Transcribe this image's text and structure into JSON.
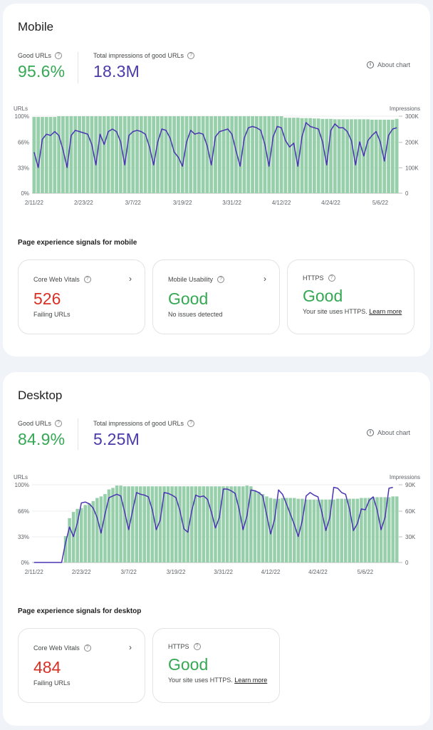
{
  "colors": {
    "good_green": "#34a853",
    "impressions_purple": "#4a3aaa",
    "failing_red": "#d93025",
    "bar_green": "#97cfab",
    "line_purple": "#4b34b4"
  },
  "mobile": {
    "title": "Mobile",
    "good_urls_label": "Good URLs",
    "good_urls_value": "95.6%",
    "impressions_label": "Total impressions of good URLs",
    "impressions_value": "18.3M",
    "about_chart": "About chart",
    "signals_title": "Page experience signals for mobile",
    "cards": [
      {
        "label": "Core Web Vitals",
        "value": "526",
        "sub": "Failing URLs",
        "has_chevron": true
      },
      {
        "label": "Mobile Usability",
        "value": "Good",
        "sub": "No issues detected",
        "has_chevron": true
      },
      {
        "label": "HTTPS",
        "value": "Good",
        "sub": "Your site uses HTTPS.",
        "link": "Learn more",
        "has_chevron": false
      }
    ]
  },
  "desktop": {
    "title": "Desktop",
    "good_urls_label": "Good URLs",
    "good_urls_value": "84.9%",
    "impressions_label": "Total impressions of good URLs",
    "impressions_value": "5.25M",
    "about_chart": "About chart",
    "signals_title": "Page experience signals for desktop",
    "cards": [
      {
        "label": "Core Web Vitals",
        "value": "484",
        "sub": "Failing URLs",
        "has_chevron": true
      },
      {
        "label": "HTTPS",
        "value": "Good",
        "sub": "Your site uses HTTPS.",
        "link": "Learn more",
        "has_chevron": false
      }
    ]
  },
  "chart_data": [
    {
      "type": "bar",
      "title": "Mobile",
      "ylabel": "URLs",
      "y2label": "Impressions",
      "ylim": [
        0,
        100
      ],
      "y2lim": [
        0,
        300000
      ],
      "yticks": [
        "0%",
        "33%",
        "66%",
        "100%"
      ],
      "y2ticks": [
        "0",
        "100K",
        "200K",
        "300K"
      ],
      "xticks": [
        "2/11/22",
        "2/23/22",
        "3/7/22",
        "3/19/22",
        "3/31/22",
        "4/12/22",
        "4/24/22",
        "5/6/22"
      ],
      "grid": true,
      "series": [
        {
          "name": "Good URLs (%)",
          "type": "bar",
          "axis": "left",
          "values": [
            99,
            99,
            99,
            99,
            99,
            99,
            100,
            100,
            100,
            100,
            100,
            100,
            100,
            100,
            100,
            100,
            100,
            100,
            100,
            100,
            100,
            100,
            100,
            100,
            100,
            100,
            100,
            100,
            100,
            100,
            100,
            100,
            100,
            100,
            100,
            100,
            100,
            100,
            100,
            100,
            100,
            100,
            100,
            100,
            100,
            100,
            100,
            100,
            100,
            100,
            100,
            100,
            100,
            100,
            100,
            100,
            100,
            100,
            100,
            100,
            100,
            98,
            98,
            98,
            98,
            97.5,
            97.5,
            97.5,
            97,
            97,
            96.5,
            96.5,
            96.5,
            96,
            96,
            96,
            96,
            96,
            96,
            96,
            96,
            96,
            95.5,
            95.5,
            95.5,
            95.5,
            95.5,
            95.5,
            96.5
          ]
        },
        {
          "name": "Impressions",
          "type": "line",
          "axis": "right",
          "values": [
            160000,
            100000,
            210000,
            230000,
            225000,
            240000,
            225000,
            170000,
            100000,
            225000,
            245000,
            240000,
            235000,
            230000,
            190000,
            110000,
            230000,
            190000,
            240000,
            250000,
            240000,
            200000,
            110000,
            225000,
            240000,
            245000,
            240000,
            230000,
            180000,
            110000,
            200000,
            250000,
            245000,
            215000,
            160000,
            140000,
            105000,
            200000,
            245000,
            230000,
            235000,
            230000,
            185000,
            110000,
            220000,
            240000,
            245000,
            250000,
            230000,
            165000,
            105000,
            215000,
            255000,
            260000,
            255000,
            245000,
            190000,
            105000,
            220000,
            260000,
            255000,
            205000,
            180000,
            195000,
            105000,
            220000,
            275000,
            260000,
            255000,
            250000,
            200000,
            110000,
            245000,
            270000,
            255000,
            255000,
            240000,
            205000,
            110000,
            200000,
            145000,
            205000,
            225000,
            240000,
            200000,
            125000,
            225000,
            250000,
            255000
          ]
        }
      ]
    },
    {
      "type": "bar",
      "title": "Desktop",
      "ylabel": "URLs",
      "y2label": "Impressions",
      "ylim": [
        0,
        100
      ],
      "y2lim": [
        0,
        90000
      ],
      "yticks": [
        "0%",
        "33%",
        "66%",
        "100%"
      ],
      "y2ticks": [
        "0",
        "30K",
        "60K",
        "90K"
      ],
      "xticks": [
        "2/11/22",
        "2/23/22",
        "3/7/22",
        "3/19/22",
        "3/31/22",
        "4/12/22",
        "4/24/22",
        "5/6/22"
      ],
      "grid": true,
      "series": [
        {
          "name": "Good URLs (%)",
          "type": "bar",
          "axis": "left",
          "values": [
            0,
            0,
            0,
            0,
            0,
            0,
            0,
            0,
            34,
            57,
            65,
            69,
            70,
            74,
            76,
            79,
            83,
            85,
            88,
            94,
            96,
            99,
            99,
            98,
            98,
            98,
            98,
            98,
            98,
            98,
            98,
            98,
            98,
            98,
            98,
            98,
            98,
            98,
            98,
            98,
            98,
            98,
            98,
            98,
            98,
            98,
            98,
            98,
            98,
            98,
            98,
            98,
            98,
            98,
            99,
            98,
            93,
            91,
            88,
            85,
            83,
            82,
            82,
            83,
            83,
            83,
            83,
            82,
            82,
            81,
            81,
            81,
            81,
            81,
            81,
            81,
            81,
            82,
            82,
            82,
            82,
            82,
            82,
            83,
            83,
            83,
            84,
            84,
            84,
            84,
            84,
            85,
            85
          ]
        },
        {
          "name": "Impressions",
          "type": "line",
          "axis": "right",
          "values": [
            0,
            0,
            0,
            0,
            0,
            0,
            0,
            0,
            23000,
            41000,
            30000,
            46000,
            69000,
            70000,
            68000,
            63000,
            52000,
            34000,
            56000,
            75000,
            77000,
            79000,
            77000,
            58000,
            38000,
            60000,
            81000,
            79000,
            78000,
            76000,
            61000,
            38000,
            49000,
            81000,
            80000,
            78000,
            75000,
            60000,
            39000,
            35000,
            60000,
            78000,
            76000,
            77000,
            73000,
            58000,
            40000,
            52000,
            85000,
            85000,
            83000,
            80000,
            62000,
            38000,
            54000,
            84000,
            83000,
            81000,
            77000,
            55000,
            33000,
            50000,
            84000,
            79000,
            68000,
            56000,
            44000,
            30000,
            48000,
            77000,
            81000,
            78000,
            76000,
            58000,
            37000,
            52000,
            87000,
            86000,
            81000,
            79000,
            62000,
            37000,
            45000,
            62000,
            61000,
            72000,
            76000,
            61000,
            38000,
            52000,
            86000,
            87000
          ]
        }
      ]
    }
  ]
}
